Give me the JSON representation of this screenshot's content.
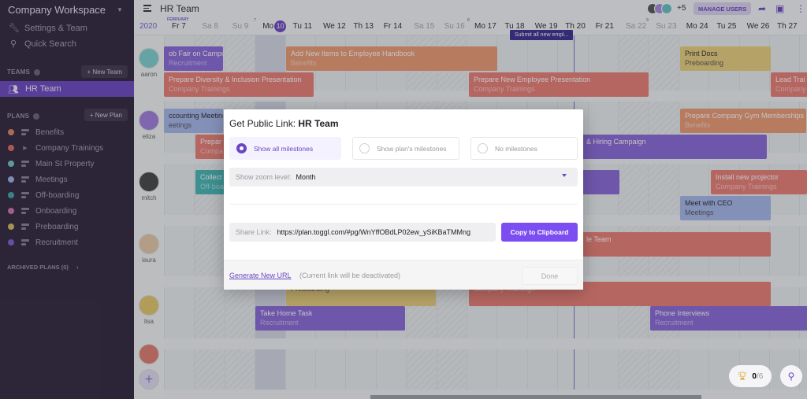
{
  "sidebar": {
    "workspace": "Company Workspace",
    "settings": "Settings & Team",
    "quick_search": "Quick Search",
    "teams_label": "TEAMS",
    "new_team": "+ New Team",
    "active_team": "HR Team",
    "plans_label": "PLANS",
    "new_plan": "+ New Plan",
    "plans": [
      {
        "label": "Benefits",
        "color": "#e0855a",
        "expandable": false
      },
      {
        "label": "Company Trainings",
        "color": "#e06a5e",
        "expandable": true
      },
      {
        "label": "Main St Property",
        "color": "#6fc7c7",
        "expandable": false
      },
      {
        "label": "Meetings",
        "color": "#9fb2e6",
        "expandable": false
      },
      {
        "label": "Off-boarding",
        "color": "#3aa8a8",
        "expandable": false
      },
      {
        "label": "Onboarding",
        "color": "#d66fb0",
        "expandable": false
      },
      {
        "label": "Preboarding",
        "color": "#d9bb5e",
        "expandable": false
      },
      {
        "label": "Recruitment",
        "color": "#7d5bd6",
        "expandable": false
      }
    ],
    "archived": "ARCHIVED PLANS (0)"
  },
  "header": {
    "title": "HR Team",
    "extra_users": "+5",
    "manage_users": "MANAGE USERS"
  },
  "timeline": {
    "year": "2020",
    "month": "FEBRUARY",
    "week_numbers": [
      "7",
      "8",
      "9"
    ],
    "days": [
      {
        "label": "Fr 7",
        "weekend": false
      },
      {
        "label": "Sa 8",
        "weekend": true
      },
      {
        "label": "Su 9",
        "weekend": true
      },
      {
        "label": "Mo",
        "weekend": false,
        "today": "10"
      },
      {
        "label": "Tu 11",
        "weekend": false
      },
      {
        "label": "We 12",
        "weekend": false
      },
      {
        "label": "Th 13",
        "weekend": false
      },
      {
        "label": "Fr 14",
        "weekend": false
      },
      {
        "label": "Sa 15",
        "weekend": true
      },
      {
        "label": "Su 16",
        "weekend": true
      },
      {
        "label": "Mo 17",
        "weekend": false
      },
      {
        "label": "Tu 18",
        "weekend": false
      },
      {
        "label": "We 19",
        "weekend": false
      },
      {
        "label": "Th 20",
        "weekend": false
      },
      {
        "label": "Fr 21",
        "weekend": false
      },
      {
        "label": "Sa 22",
        "weekend": true
      },
      {
        "label": "Su 23",
        "weekend": true
      },
      {
        "label": "Mo 24",
        "weekend": false
      },
      {
        "label": "Tu 25",
        "weekend": false
      },
      {
        "label": "We 26",
        "weekend": false
      },
      {
        "label": "Th 27",
        "weekend": false
      }
    ],
    "milestone": "Submit all new empl...",
    "people": [
      "aaron",
      "eliza",
      "mitch",
      "laura",
      "lisa"
    ],
    "tasks": [
      {
        "title": "ob Fair on Campus",
        "plan": "Recruitment",
        "color": "#8a67d8"
      },
      {
        "title": "Add New Items to Employee Handbook",
        "plan": "Benefits",
        "color": "#ef9a72"
      },
      {
        "title": "Print Docs",
        "plan": "Preboarding",
        "color": "#ecd07a",
        "light": true
      },
      {
        "title": "Prepare Diversity & Inclusion Presentation",
        "plan": "Company Trainings",
        "color": "#ee7d74"
      },
      {
        "title": "Prepare New Employee Presentation",
        "plan": "Company Trainings",
        "color": "#ee7d74"
      },
      {
        "title": "Lead Trai",
        "plan": "Company",
        "color": "#ee7d74"
      },
      {
        "title": "ccounting Meeting",
        "plan": "eetings",
        "color": "#a7b8ec",
        "light": true
      },
      {
        "title": "Prepare Company Gym Memberships",
        "plan": "Benefits",
        "color": "#ef9a72"
      },
      {
        "title": "Prepar",
        "plan": "Compa",
        "color": "#ee7d74"
      },
      {
        "title": "& Hiring Campaign",
        "plan": "",
        "color": "#8a67d8"
      },
      {
        "title": "Collect",
        "plan": "Off-boa",
        "color": "#44b7b5"
      },
      {
        "title": "",
        "plan": "",
        "color": "#8a67d8"
      },
      {
        "title": "Install new projector",
        "plan": "Company Trainings",
        "color": "#ee7d74"
      },
      {
        "title": "Meet with CEO",
        "plan": "Meetings",
        "color": "#a7b8ec",
        "light": true
      },
      {
        "title": "le Team",
        "plan": "",
        "color": "#ee7d74"
      },
      {
        "title": "",
        "plan": "Preboarding",
        "color": "#ecd07a",
        "light": true
      },
      {
        "title": "",
        "plan": "Company Trainings",
        "color": "#ee7d74"
      },
      {
        "title": "Take Home Task",
        "plan": "Recruitment",
        "color": "#8a67d8"
      },
      {
        "title": "Phone Interviews",
        "plan": "Recruitment",
        "color": "#8a67d8"
      }
    ]
  },
  "goals": {
    "done": "0",
    "total": "/6"
  },
  "modal": {
    "title_prefix": "Get Public Link: ",
    "title_team": "HR Team",
    "options": [
      {
        "label": "Show all milestones",
        "selected": true
      },
      {
        "label": "Show plan's milestones",
        "selected": false
      },
      {
        "label": "No milestones",
        "selected": false
      }
    ],
    "zoom_label": "Show zoom level:",
    "zoom_value": "Month",
    "share_label": "Share Link:",
    "share_url": "https://plan.toggl.com/#pg/WnYffOBdLP02ew_ySiKBaTMMng",
    "copy_button": "Copy to Clipboard",
    "generate_link": "Generate New URL",
    "generate_note": "(Current link will be deactivated)",
    "done_button": "Done"
  },
  "colors": {
    "accent": "#6b46c1",
    "sidebar_bg": "#2e2339"
  }
}
